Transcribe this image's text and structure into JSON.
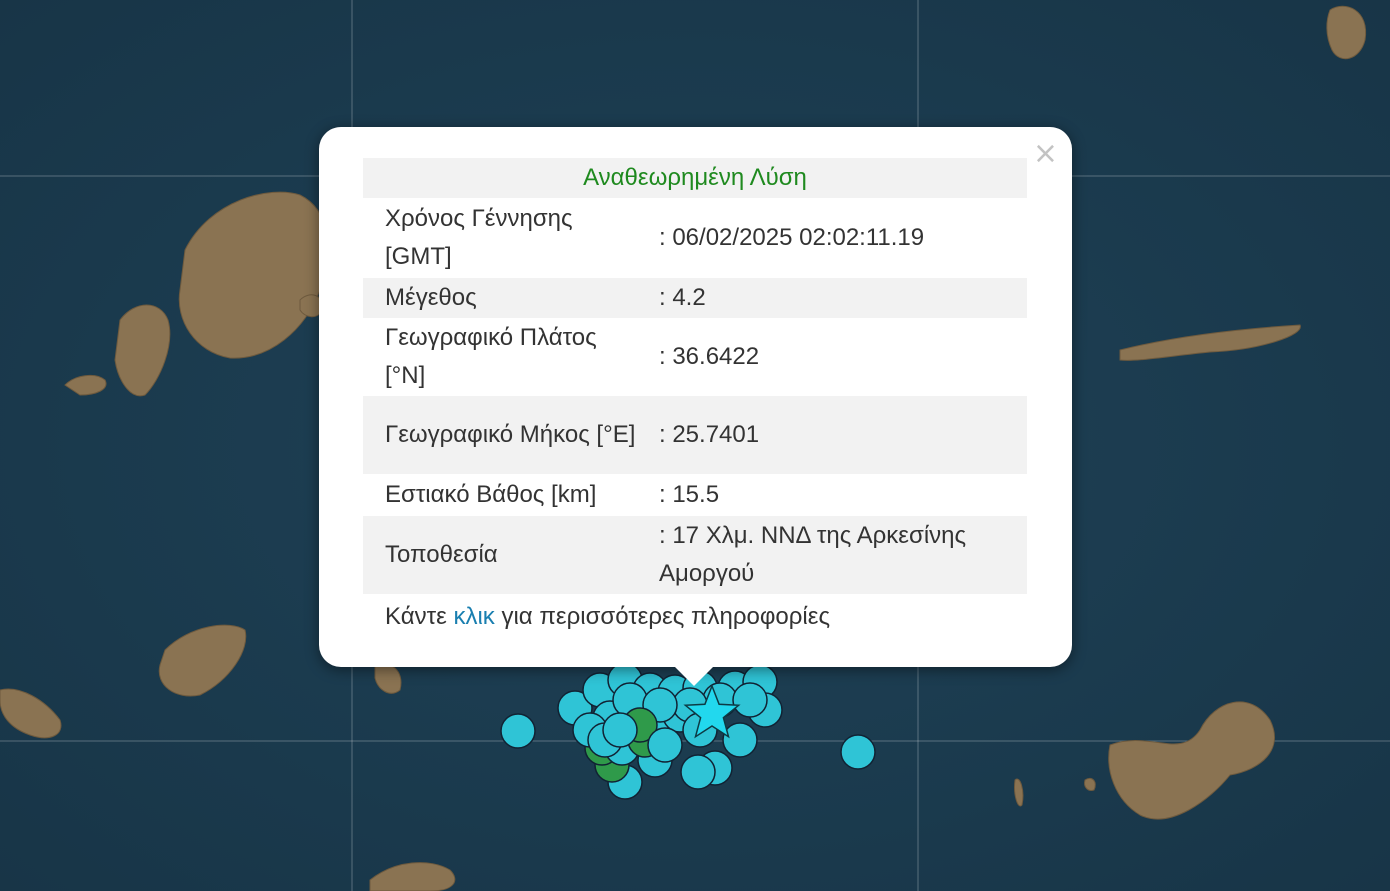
{
  "popup": {
    "close_label": "×",
    "title": "Αναθεωρημένη Λύση",
    "rows": [
      {
        "label": "Χρόνος Γέννησης [GMT]",
        "value": ": 06/02/2025 02:02:11.19"
      },
      {
        "label": "Μέγεθος",
        "value": ": 4.2"
      },
      {
        "label": "Γεωγραφικό Πλάτος [°N]",
        "value": ": 36.6422"
      },
      {
        "label": "Γεωγραφικό Μήκος [°E]",
        "value": ": 25.7401"
      },
      {
        "label": "Εστιακό Βάθος [km]",
        "value": ": 15.5"
      },
      {
        "label": "Τοποθεσία",
        "value": ": 17 Χλμ. ΝΝΔ της Αρκεσίνης Αμοργού"
      }
    ],
    "footer_before": "Κάντε ",
    "footer_link": "κλικ",
    "footer_after": " για περισσότερες πληροφορίες"
  },
  "map": {
    "sea_color": "#1c3a4f",
    "land_color": "#8a7352",
    "marker_color": "#2fc4d6",
    "marker_alt_color": "#2f9a4a",
    "star_color": "#22d8ee",
    "star_icon": "star-icon"
  }
}
